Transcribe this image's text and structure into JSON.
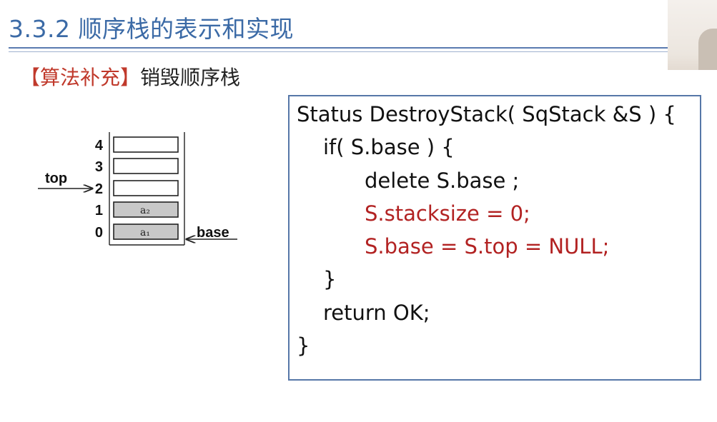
{
  "header": {
    "title": "3.3.2 顺序栈的表示和实现"
  },
  "subtitle": {
    "bracketed": "【算法补充】",
    "text": "销毁顺序栈"
  },
  "diagram": {
    "indices": [
      "4",
      "3",
      "2",
      "1",
      "0"
    ],
    "cells": [
      "",
      "",
      "",
      "a₂",
      "a₁"
    ],
    "top_label": "top",
    "base_label": "base"
  },
  "code": {
    "lines": [
      "Status DestroyStack( SqStack &S ) {",
      "if( S.base ) {",
      "delete S.base ;",
      "S.stacksize = 0;",
      "S.base = S.top = NULL;",
      "}",
      "return OK;",
      "}"
    ],
    "highlight_color": "#b22222"
  },
  "colors": {
    "title": "#3b6aa6",
    "bracket": "#c0392b",
    "border": "#5677a8",
    "filled_cell": "#c8c8c8"
  }
}
